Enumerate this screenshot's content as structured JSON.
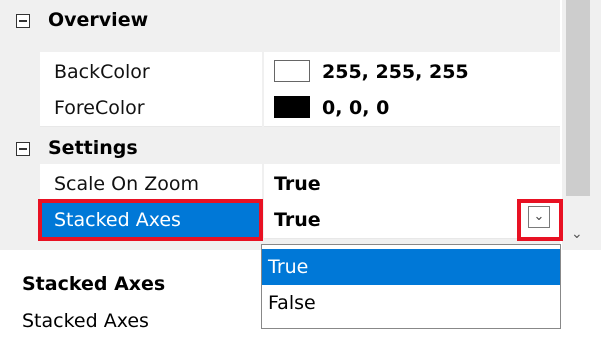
{
  "categories": [
    {
      "label": "Overview"
    },
    {
      "label": "Settings"
    }
  ],
  "overview": {
    "props": [
      {
        "name": "BackColor",
        "value": "255, 255, 255",
        "swatch": "#ffffff"
      },
      {
        "name": "ForeColor",
        "value": "0, 0, 0",
        "swatch": "#000000"
      }
    ]
  },
  "settings": {
    "props": [
      {
        "name": "Scale On Zoom",
        "value": "True"
      },
      {
        "name": "Stacked Axes",
        "value": "True"
      }
    ]
  },
  "dropdown": {
    "options": [
      "True",
      "False"
    ],
    "selected": "True"
  },
  "description": {
    "title": "Stacked Axes",
    "text": "Stacked Axes"
  },
  "colors": {
    "selection": "#0078d7",
    "highlight": "#e81123"
  }
}
